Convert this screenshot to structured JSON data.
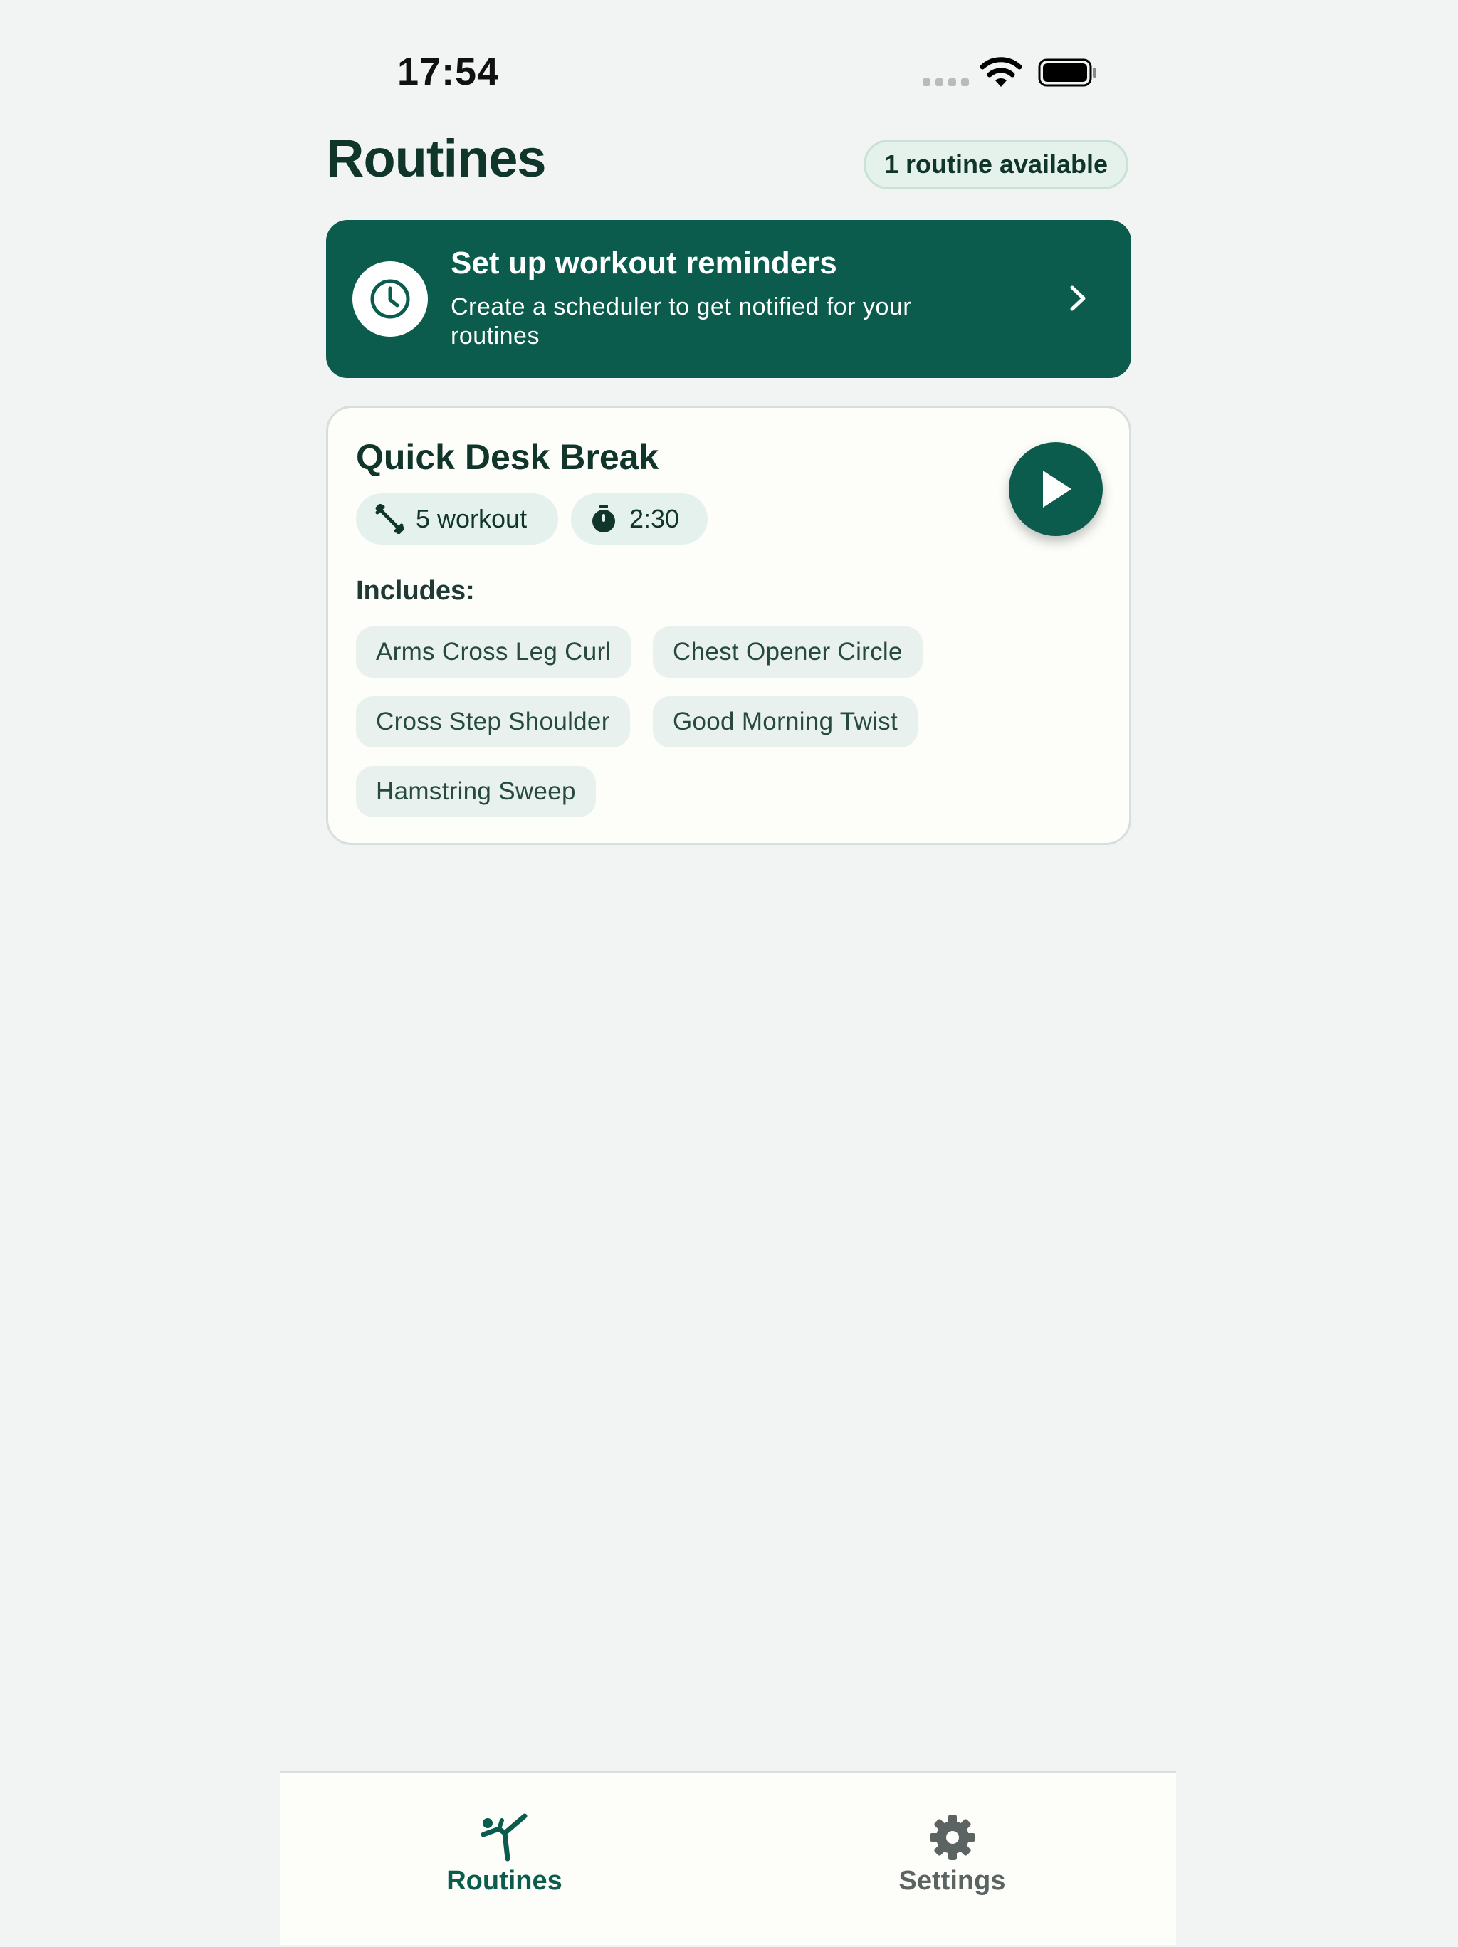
{
  "status_bar": {
    "time": "17:54"
  },
  "header": {
    "title": "Routines",
    "badge": "1 routine available"
  },
  "reminder_banner": {
    "title": "Set up workout reminders",
    "subtitle": "Create a scheduler to get notified for your routines"
  },
  "routine": {
    "name": "Quick Desk Break",
    "workout_count": "5 workout",
    "duration": "2:30",
    "includes_label": "Includes:",
    "exercises": [
      "Arms Cross Leg Curl",
      "Chest Opener Circle",
      "Cross Step Shoulder",
      "Good Morning Twist",
      "Hamstring Sweep"
    ]
  },
  "tabs": [
    {
      "label": "Routines",
      "icon": "stretch-figure-icon",
      "active": true
    },
    {
      "label": "Settings",
      "icon": "gear-icon",
      "active": false
    }
  ],
  "colors": {
    "accent": "#0b5c4c",
    "background": "#f1f4f2",
    "inactive_tab": "#5b6462"
  }
}
